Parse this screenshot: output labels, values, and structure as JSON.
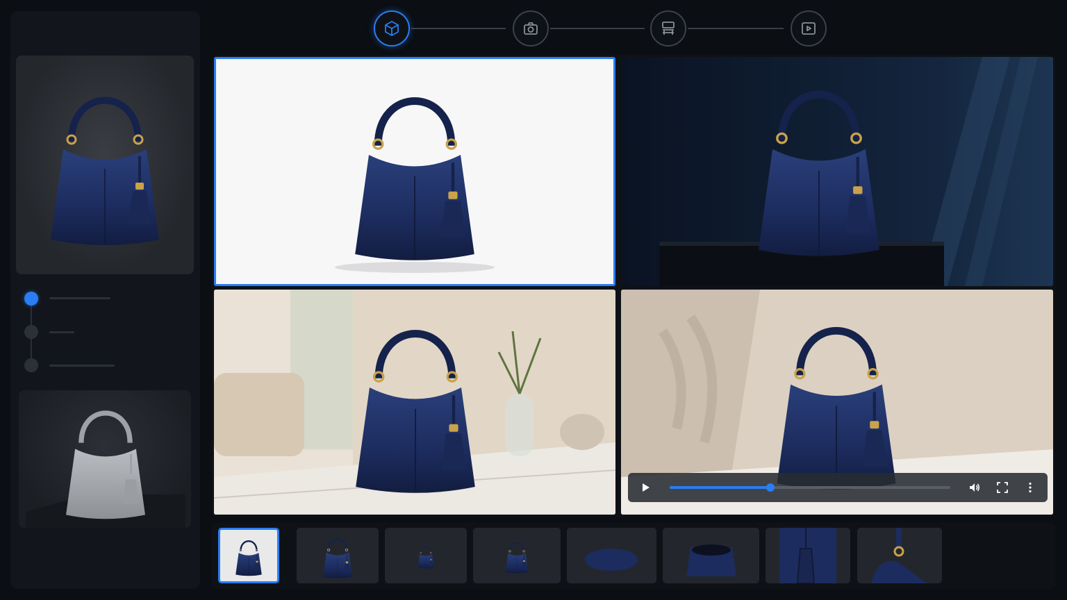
{
  "colors": {
    "accent": "#2a7df4",
    "background": "#0b0e13",
    "panel": "#12161c",
    "bag_navy": "#1c2c5e"
  },
  "stepper": {
    "steps": [
      {
        "icon": "cube-icon",
        "active": true
      },
      {
        "icon": "camera-icon",
        "active": false
      },
      {
        "icon": "layout-icon",
        "active": false
      },
      {
        "icon": "play-icon",
        "active": false
      }
    ]
  },
  "sidebar": {
    "preview_top": "navy-bag-preview",
    "preview_bottom": "gray-3d-model-preview",
    "steps": [
      {
        "active": true
      },
      {
        "active": false
      },
      {
        "active": false
      }
    ]
  },
  "gallery": {
    "tiles": [
      {
        "scene": "white-studio",
        "selected": true
      },
      {
        "scene": "dark-pedestal",
        "selected": false
      },
      {
        "scene": "living-room-table",
        "selected": false
      },
      {
        "scene": "video-shadow-wall",
        "selected": false
      }
    ]
  },
  "video": {
    "progress": 0.36,
    "icons": [
      "play-icon",
      "volume-icon",
      "fullscreen-icon",
      "more-icon"
    ]
  },
  "thumbnails": [
    {
      "view": "front",
      "active": true
    },
    {
      "view": "front-dark",
      "active": false
    },
    {
      "view": "side",
      "active": false
    },
    {
      "view": "three-quarter",
      "active": false
    },
    {
      "view": "bottom",
      "active": false
    },
    {
      "view": "interior",
      "active": false
    },
    {
      "view": "tassel-detail",
      "active": false
    },
    {
      "view": "hardware-detail",
      "active": false
    }
  ]
}
